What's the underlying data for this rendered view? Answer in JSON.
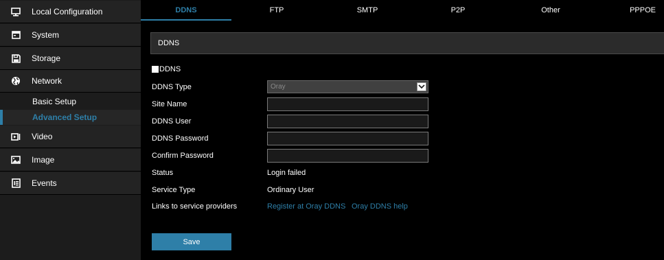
{
  "sidebar": {
    "items": [
      {
        "label": "Local Configuration",
        "icon": "monitor-icon"
      },
      {
        "label": "System",
        "icon": "system-icon"
      },
      {
        "label": "Storage",
        "icon": "floppy-icon"
      },
      {
        "label": "Network",
        "icon": "globe-icon"
      },
      {
        "label": "Video",
        "icon": "video-icon"
      },
      {
        "label": "Image",
        "icon": "image-icon"
      },
      {
        "label": "Events",
        "icon": "events-icon"
      }
    ],
    "network_sub": [
      {
        "label": "Basic Setup"
      },
      {
        "label": "Advanced Setup"
      }
    ]
  },
  "tabs": [
    {
      "label": "DDNS"
    },
    {
      "label": "FTP"
    },
    {
      "label": "SMTP"
    },
    {
      "label": "P2P"
    },
    {
      "label": "Other"
    },
    {
      "label": "PPPOE"
    }
  ],
  "section": {
    "title": "DDNS"
  },
  "form": {
    "enable_label": "DDNS",
    "ddns_type_label": "DDNS Type",
    "ddns_type_value": "Oray",
    "site_name_label": "Site Name",
    "ddns_user_label": "DDNS User",
    "ddns_password_label": "DDNS Password",
    "confirm_password_label": "Confirm Password",
    "status_label": "Status",
    "status_value": "Login failed",
    "service_type_label": "Service Type",
    "service_type_value": "Ordinary User",
    "links_label": "Links to service providers",
    "link_register": "Register at Oray DDNS",
    "link_help": "Oray DDNS help",
    "save_label": "Save"
  },
  "colors": {
    "accent": "#2e7fa8",
    "sidebar_bg": "#232323",
    "page_bg": "#000000"
  }
}
